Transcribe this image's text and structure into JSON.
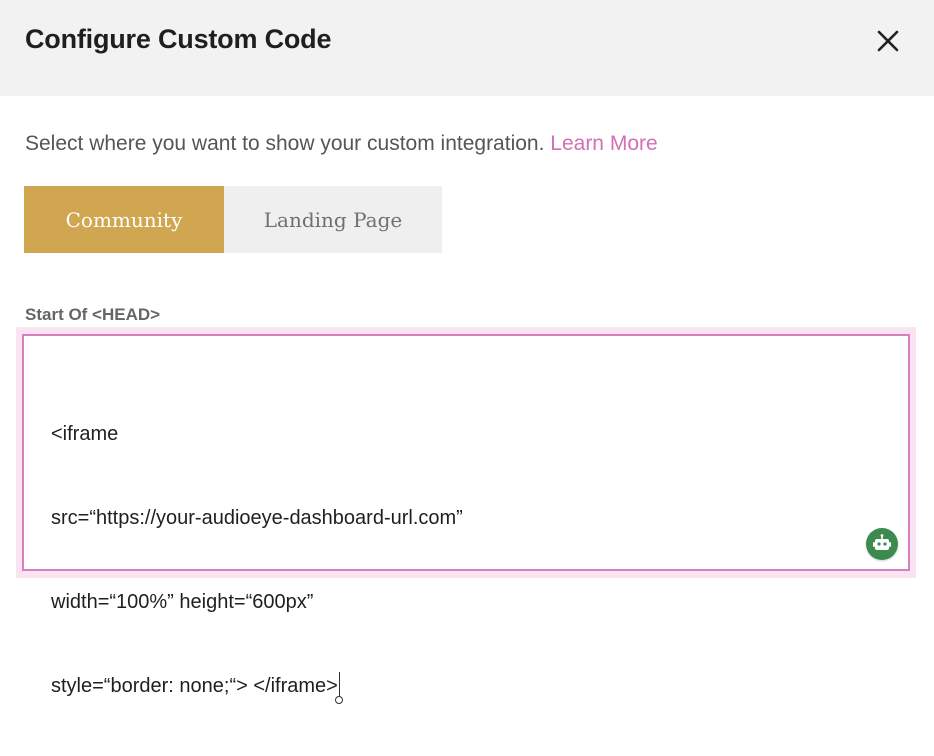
{
  "dialog": {
    "title": "Configure Custom Code"
  },
  "description": {
    "text": "Select where you want to show your custom integration.",
    "link_label": "Learn More"
  },
  "tabs": [
    {
      "label": "Community",
      "active": true
    },
    {
      "label": "Landing Page",
      "active": false
    }
  ],
  "editor": {
    "label": "Start Of <HEAD>",
    "lines": [
      "<iframe",
      "src=“https://your-audioeye-dashboard-url.com”",
      "width=“100%” height=“600px”",
      "style=“border: none;“> </iframe>"
    ]
  },
  "icons": {
    "close": "close-icon",
    "assistant": "robot-icon"
  },
  "colors": {
    "active_tab": "#d1a650",
    "link": "#d46fb3",
    "editor_border": "#d77fc0",
    "assistant_button": "#3c8a4e"
  }
}
